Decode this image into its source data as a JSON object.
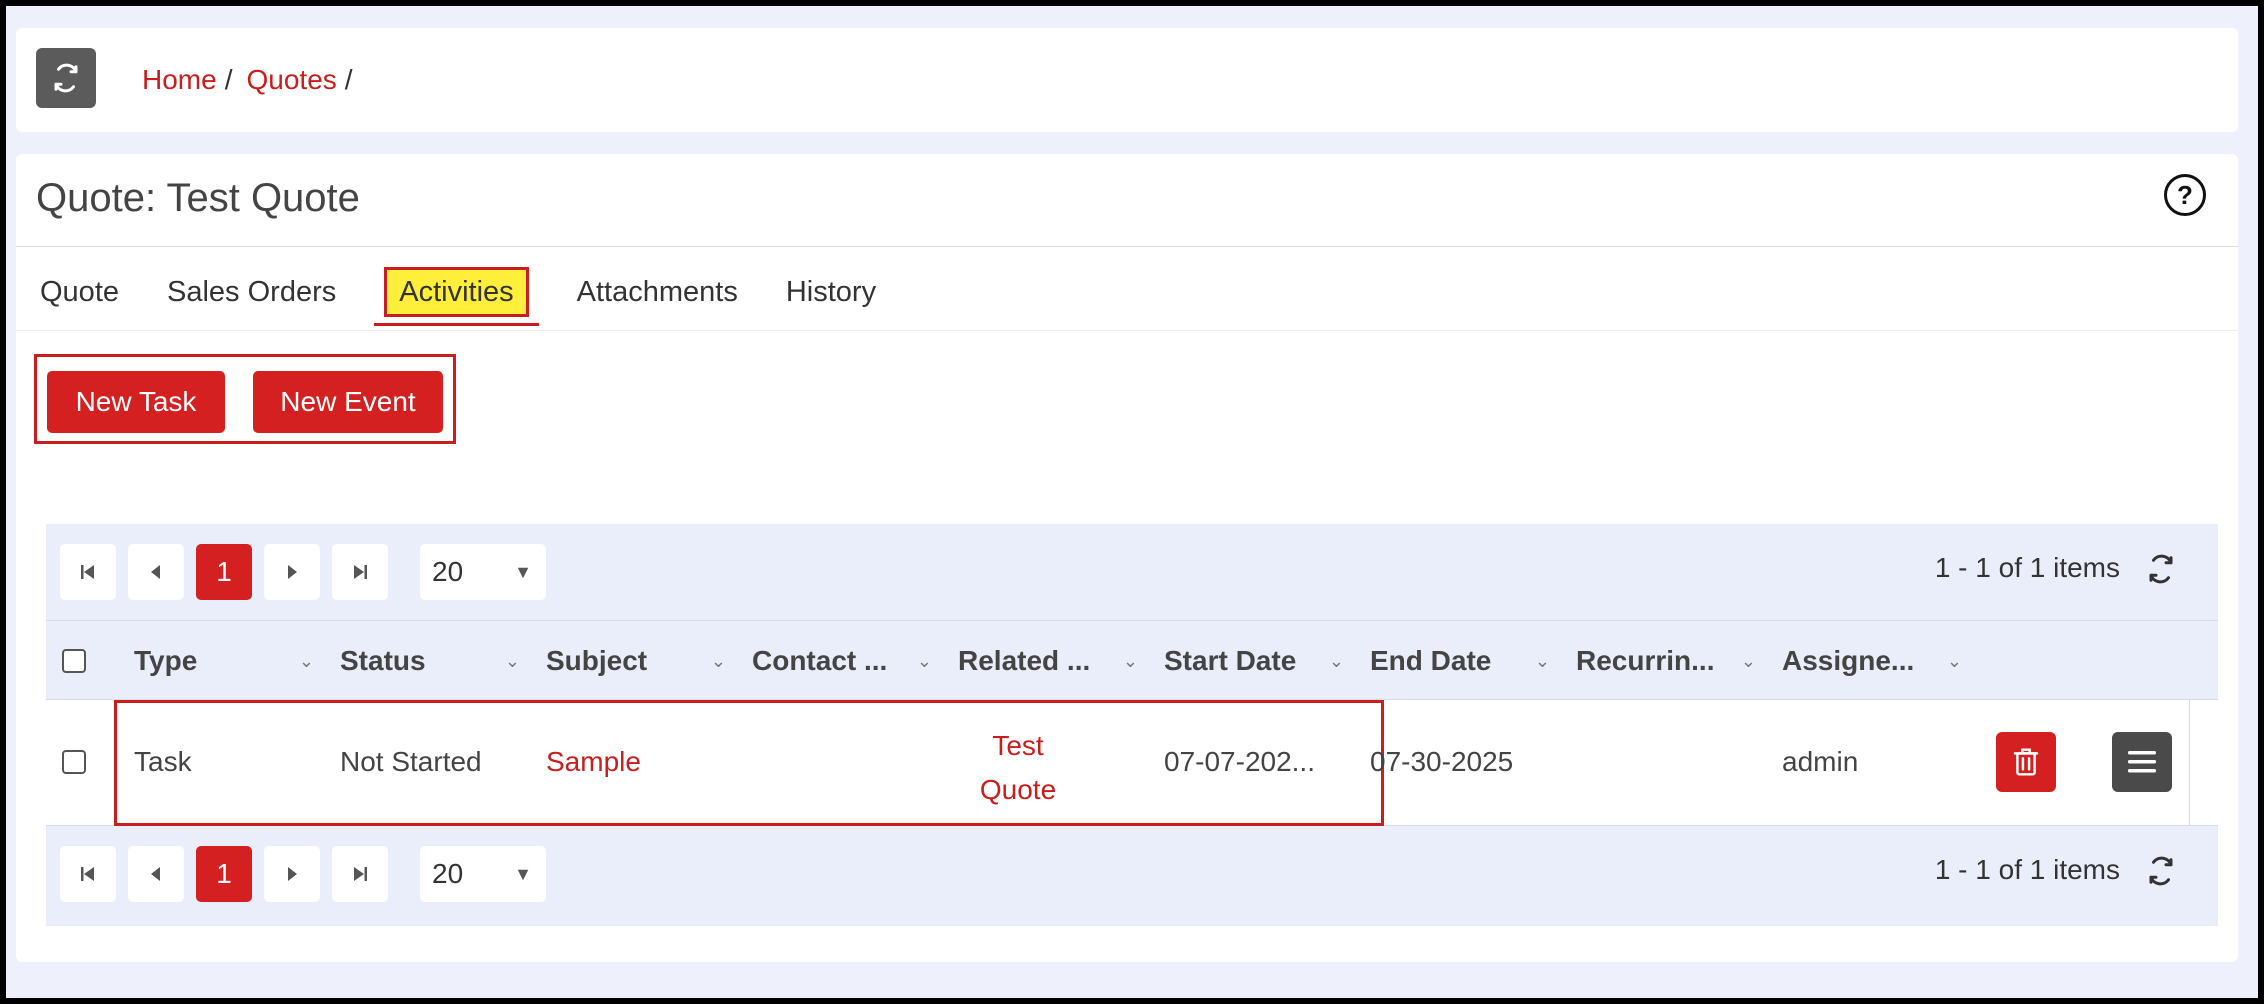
{
  "breadcrumb": {
    "items": [
      "Home",
      "Quotes"
    ],
    "separator": "/"
  },
  "page": {
    "title": "Quote: Test Quote"
  },
  "tabs": [
    {
      "label": "Quote"
    },
    {
      "label": "Sales Orders"
    },
    {
      "label": "Activities",
      "active": true
    },
    {
      "label": "Attachments"
    },
    {
      "label": "History"
    }
  ],
  "actions": {
    "new_task": "New Task",
    "new_event": "New Event"
  },
  "pager": {
    "current_page": "1",
    "page_size": "20",
    "info": "1 - 1 of 1 items"
  },
  "columns": [
    "Type",
    "Status",
    "Subject",
    "Contact ...",
    "Related ...",
    "Start Date",
    "End Date",
    "Recurrin...",
    "Assigne..."
  ],
  "rows": [
    {
      "type": "Task",
      "status": "Not Started",
      "subject": "Sample",
      "contact": "",
      "related_line1": "Test",
      "related_line2": "Quote",
      "start_date": "07-07-202...",
      "end_date": "07-30-2025",
      "recurring": "",
      "assigned": "admin"
    }
  ],
  "icons": {
    "refresh": "refresh-icon",
    "help": "help-icon",
    "first": "first-page-icon",
    "prev": "prev-page-icon",
    "next": "next-page-icon",
    "last": "last-page-icon",
    "trash": "trash-icon",
    "menu": "menu-icon"
  },
  "colors": {
    "accent": "#d42020",
    "highlight": "#ffee3a"
  }
}
